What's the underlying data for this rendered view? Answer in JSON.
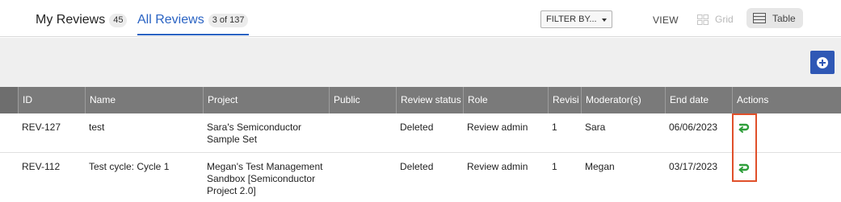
{
  "tabs": {
    "my_reviews": {
      "label": "My Reviews",
      "count": "45"
    },
    "all_reviews": {
      "label": "All Reviews",
      "count": "3 of 137"
    }
  },
  "toolbar": {
    "filter_label": "FILTER BY...",
    "view_label": "VIEW",
    "grid_label": "Grid",
    "table_label": "Table"
  },
  "colors": {
    "accent": "#2a63c3",
    "header_bg": "#7a7a7a",
    "add_button": "#2f58b5",
    "highlight": "#e0502a",
    "action_icon": "#2e9e3a"
  },
  "table": {
    "columns": [
      "ID",
      "Name",
      "Project",
      "Public",
      "Review status",
      "Role",
      "Revisi",
      "Moderator(s)",
      "End date",
      "Actions"
    ],
    "rows": [
      {
        "id": "REV-127",
        "name": "test",
        "project": "Sara's Semiconductor Sample Set",
        "public": "",
        "status": "Deleted",
        "role": "Review admin",
        "revision": "1",
        "moderator": "Sara",
        "end_date": "06/06/2023",
        "action_icon": "restore-icon"
      },
      {
        "id": "REV-112",
        "name": "Test cycle: Cycle 1",
        "project": "Megan's Test Management Sandbox [Semiconductor Project 2.0]",
        "public": "",
        "status": "Deleted",
        "role": "Review admin",
        "revision": "1",
        "moderator": "Megan",
        "end_date": "03/17/2023",
        "action_icon": "restore-icon"
      }
    ]
  }
}
